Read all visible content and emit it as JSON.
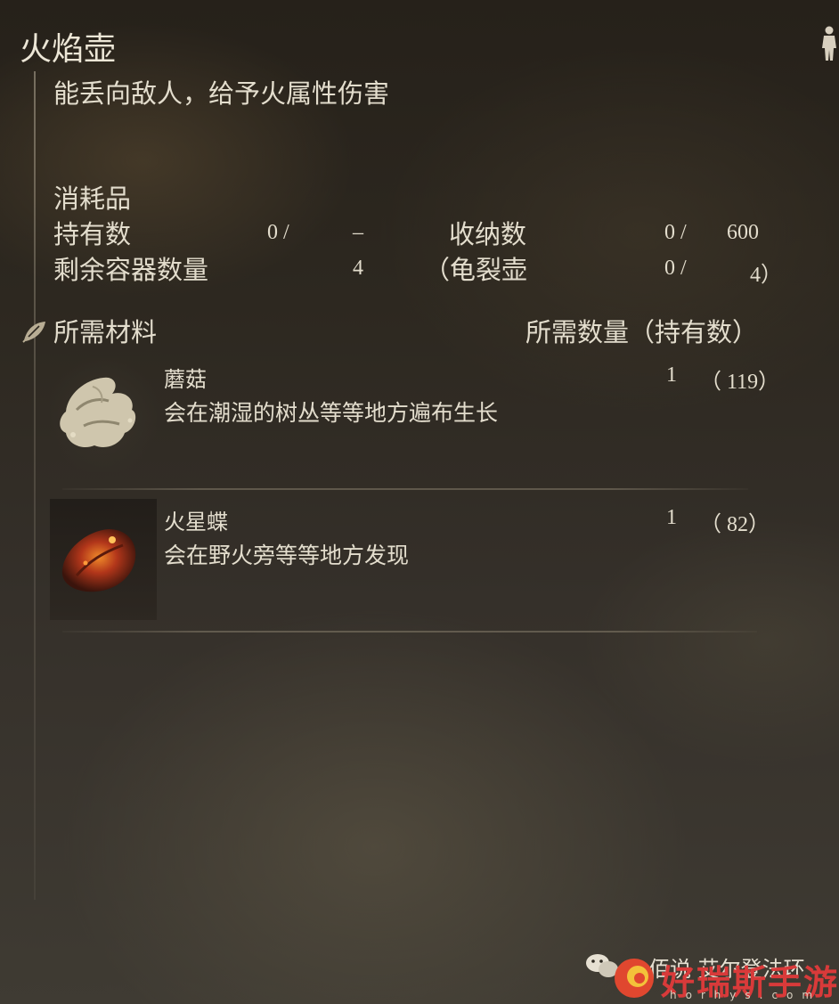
{
  "item": {
    "name": "火焰壶",
    "description": "能丢向敌人，给予火属性伤害",
    "category": "消耗品"
  },
  "stats": {
    "held_label": "持有数",
    "held_value": "0 /",
    "held_max": "–",
    "storage_label": "收纳数",
    "storage_value": "0 /",
    "storage_max": "600",
    "containers_label": "剩余容器数量",
    "containers_value": "4",
    "cracked_label": "（龟裂壶",
    "cracked_value": "0 /",
    "cracked_max": "4）"
  },
  "materials": {
    "header": "所需材料",
    "qty_header": "所需数量（持有数）",
    "list": [
      {
        "name": "蘑菇",
        "description": "会在潮湿的树丛等等地方遍布生长",
        "required": "1",
        "held": "（  119）",
        "icon": "mushroom-icon"
      },
      {
        "name": "火星蝶",
        "description": "会在野火旁等等地方发现",
        "required": "1",
        "held": "（    82）",
        "icon": "smoldering-butterfly-icon"
      }
    ]
  },
  "watermark": {
    "wechat_text": "佰说 艾尔登法环",
    "site_name": "好瑞斯手游网",
    "site_url": "horhys.com"
  },
  "colors": {
    "text": "#e3ddcd",
    "background": "#2d2820",
    "watermark": "#d93a3a"
  }
}
